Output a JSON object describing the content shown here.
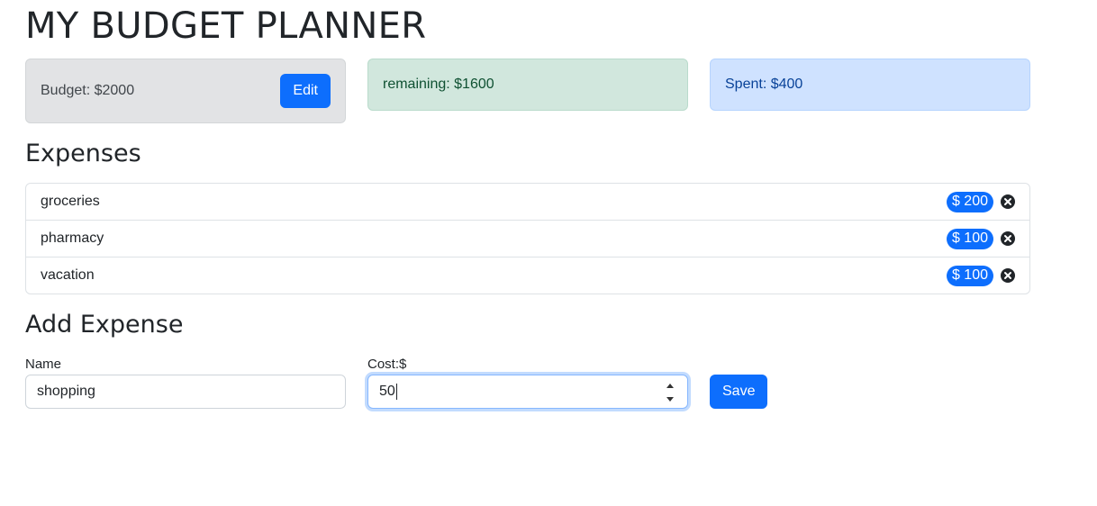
{
  "app": {
    "title": "MY BUDGET PLANNER"
  },
  "summary": {
    "budget_text": "Budget: $2000",
    "edit_label": "Edit",
    "remaining_text": "remaining: $1600",
    "spent_text": "Spent: $400"
  },
  "expenses": {
    "title": "Expenses",
    "items": [
      {
        "name": "groceries",
        "cost": "$ 200"
      },
      {
        "name": "pharmacy",
        "cost": "$ 100"
      },
      {
        "name": "vacation",
        "cost": "$ 100"
      }
    ]
  },
  "add_expense": {
    "title": "Add Expense",
    "name_label": "Name",
    "name_value": "shopping",
    "cost_label": "Cost:$",
    "cost_value": "50",
    "save_label": "Save"
  },
  "colors": {
    "primary": "#0d6efd",
    "budget_bg": "#e2e3e5",
    "remaining_bg": "#d1e7dd",
    "spent_bg": "#cfe2ff"
  },
  "icons": {
    "remove": "times-circle-icon",
    "spinner": "number-spinner-icon"
  }
}
